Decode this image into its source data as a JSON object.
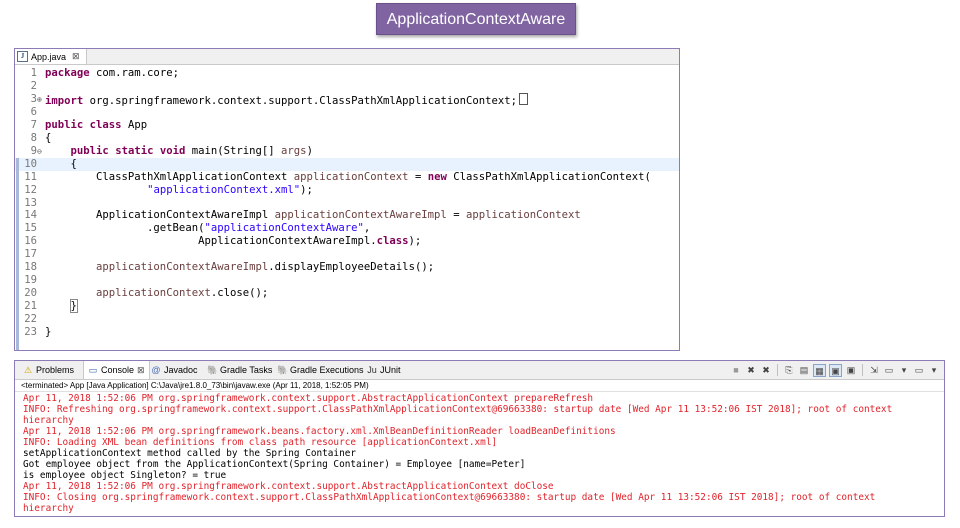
{
  "banner": {
    "title": "ApplicationContextAware",
    "color": "#8064a2"
  },
  "editor": {
    "tab_label": "App.java",
    "tab_icon": "java-file-icon",
    "lines": [
      {
        "n": "1",
        "parts": [
          [
            "kw",
            "package"
          ],
          [
            "t",
            " com.ram.core;"
          ]
        ]
      },
      {
        "n": "2",
        "parts": []
      },
      {
        "n": "3",
        "marker": "⊕",
        "parts": [
          [
            "kw",
            "import"
          ],
          [
            "t",
            " org.springframework.context.support.ClassPathXmlApplicationContext;"
          ],
          [
            "box",
            ""
          ]
        ]
      },
      {
        "n": "6",
        "parts": []
      },
      {
        "n": "7",
        "parts": [
          [
            "kw",
            "public"
          ],
          [
            "t",
            " "
          ],
          [
            "kw",
            "class"
          ],
          [
            "t",
            " App"
          ]
        ]
      },
      {
        "n": "8",
        "parts": [
          [
            "t",
            "{"
          ]
        ]
      },
      {
        "n": "9",
        "marker": "⊖",
        "parts": [
          [
            "t",
            "    "
          ],
          [
            "kw",
            "public"
          ],
          [
            "t",
            " "
          ],
          [
            "kw",
            "static"
          ],
          [
            "t",
            " "
          ],
          [
            "kw",
            "void"
          ],
          [
            "t",
            " main(String[] "
          ],
          [
            "var",
            "args"
          ],
          [
            "t",
            ")"
          ]
        ]
      },
      {
        "n": "10",
        "current": true,
        "parts": [
          [
            "t",
            "    {"
          ]
        ]
      },
      {
        "n": "11",
        "parts": [
          [
            "t",
            "        ClassPathXmlApplicationContext "
          ],
          [
            "var",
            "applicationContext"
          ],
          [
            "t",
            " = "
          ],
          [
            "kw",
            "new"
          ],
          [
            "t",
            " ClassPathXmlApplicationContext("
          ]
        ]
      },
      {
        "n": "12",
        "parts": [
          [
            "t",
            "                "
          ],
          [
            "str",
            "\"applicationContext.xml\""
          ],
          [
            "t",
            ");"
          ]
        ]
      },
      {
        "n": "13",
        "parts": []
      },
      {
        "n": "14",
        "parts": [
          [
            "t",
            "        ApplicationContextAwareImpl "
          ],
          [
            "var",
            "applicationContextAwareImpl"
          ],
          [
            "t",
            " = "
          ],
          [
            "var",
            "applicationContext"
          ]
        ]
      },
      {
        "n": "15",
        "parts": [
          [
            "t",
            "                .getBean("
          ],
          [
            "str",
            "\"applicationContextAware\""
          ],
          [
            "t",
            ","
          ]
        ]
      },
      {
        "n": "16",
        "parts": [
          [
            "t",
            "                        ApplicationContextAwareImpl."
          ],
          [
            "kw",
            "class"
          ],
          [
            "t",
            ");"
          ]
        ]
      },
      {
        "n": "17",
        "parts": []
      },
      {
        "n": "18",
        "parts": [
          [
            "t",
            "        "
          ],
          [
            "var",
            "applicationContextAwareImpl"
          ],
          [
            "t",
            ".displayEmployeeDetails();"
          ]
        ]
      },
      {
        "n": "19",
        "parts": []
      },
      {
        "n": "20",
        "parts": [
          [
            "t",
            "        "
          ],
          [
            "var",
            "applicationContext"
          ],
          [
            "t",
            ".close();"
          ]
        ]
      },
      {
        "n": "21",
        "parts": [
          [
            "t",
            "    "
          ],
          [
            "brace",
            "}"
          ]
        ]
      },
      {
        "n": "22",
        "parts": []
      },
      {
        "n": "23",
        "parts": [
          [
            "t",
            "}"
          ]
        ]
      }
    ]
  },
  "console": {
    "tabs": [
      {
        "label": "Problems",
        "icon": "problems-icon",
        "glyph": "⚠",
        "active": false
      },
      {
        "label": "Console",
        "icon": "console-icon",
        "glyph": "▭",
        "active": true,
        "close": "⊠"
      },
      {
        "label": "Javadoc",
        "icon": "javadoc-icon",
        "glyph": "@",
        "active": false
      },
      {
        "label": "Gradle Tasks",
        "icon": "gradle-tasks-icon",
        "glyph": "🐘",
        "active": false
      },
      {
        "label": "Gradle Executions",
        "icon": "gradle-executions-icon",
        "glyph": "🐘",
        "active": false
      },
      {
        "label": "JUnit",
        "icon": "junit-icon",
        "glyph": "Ju",
        "active": false
      }
    ],
    "toolbar": [
      {
        "name": "terminate-icon",
        "glyph": "■"
      },
      {
        "name": "remove-launch-icon",
        "glyph": "✖"
      },
      {
        "name": "remove-all-icon",
        "glyph": "✖"
      },
      {
        "sep": true
      },
      {
        "name": "copy-icon",
        "glyph": "⎘"
      },
      {
        "name": "scroll-lock-icon",
        "glyph": "▤"
      },
      {
        "name": "word-wrap-icon",
        "glyph": "▦",
        "pressed": true
      },
      {
        "name": "show-on-output-icon",
        "glyph": "▣",
        "pressed": true
      },
      {
        "name": "show-on-error-icon",
        "glyph": "▣"
      },
      {
        "sep": true
      },
      {
        "name": "pin-console-icon",
        "glyph": "⇲"
      },
      {
        "name": "display-console-icon",
        "glyph": "▭"
      },
      {
        "name": "display-console-dropdown-icon",
        "glyph": "▾"
      },
      {
        "name": "open-console-icon",
        "glyph": "▭"
      },
      {
        "name": "open-console-dropdown-icon",
        "glyph": "▾"
      }
    ],
    "status": "<terminated> App [Java Application] C:\\Java\\jre1.8.0_73\\bin\\javaw.exe (Apr 11, 2018, 1:52:05 PM)",
    "lines": [
      {
        "kind": "err",
        "text": "Apr 11, 2018 1:52:06 PM org.springframework.context.support.AbstractApplicationContext prepareRefresh"
      },
      {
        "kind": "err",
        "text": "INFO: Refreshing org.springframework.context.support.ClassPathXmlApplicationContext@69663380: startup date [Wed Apr 11 13:52:06 IST 2018]; root of context"
      },
      {
        "kind": "err",
        "text": "hierarchy"
      },
      {
        "kind": "err",
        "text": "Apr 11, 2018 1:52:06 PM org.springframework.beans.factory.xml.XmlBeanDefinitionReader loadBeanDefinitions"
      },
      {
        "kind": "err",
        "text": "INFO: Loading XML bean definitions from class path resource [applicationContext.xml]"
      },
      {
        "kind": "out",
        "text": "setApplicationContext method called by the Spring Container"
      },
      {
        "kind": "out",
        "text": "Got employee object from the ApplicationContext(Spring Container) = Employee [name=Peter]"
      },
      {
        "kind": "out",
        "text": "is employee object Singleton? = true"
      },
      {
        "kind": "err",
        "text": "Apr 11, 2018 1:52:06 PM org.springframework.context.support.AbstractApplicationContext doClose"
      },
      {
        "kind": "err",
        "text": "INFO: Closing org.springframework.context.support.ClassPathXmlApplicationContext@69663380: startup date [Wed Apr 11 13:52:06 IST 2018]; root of context"
      },
      {
        "kind": "err",
        "text": "hierarchy"
      }
    ]
  }
}
